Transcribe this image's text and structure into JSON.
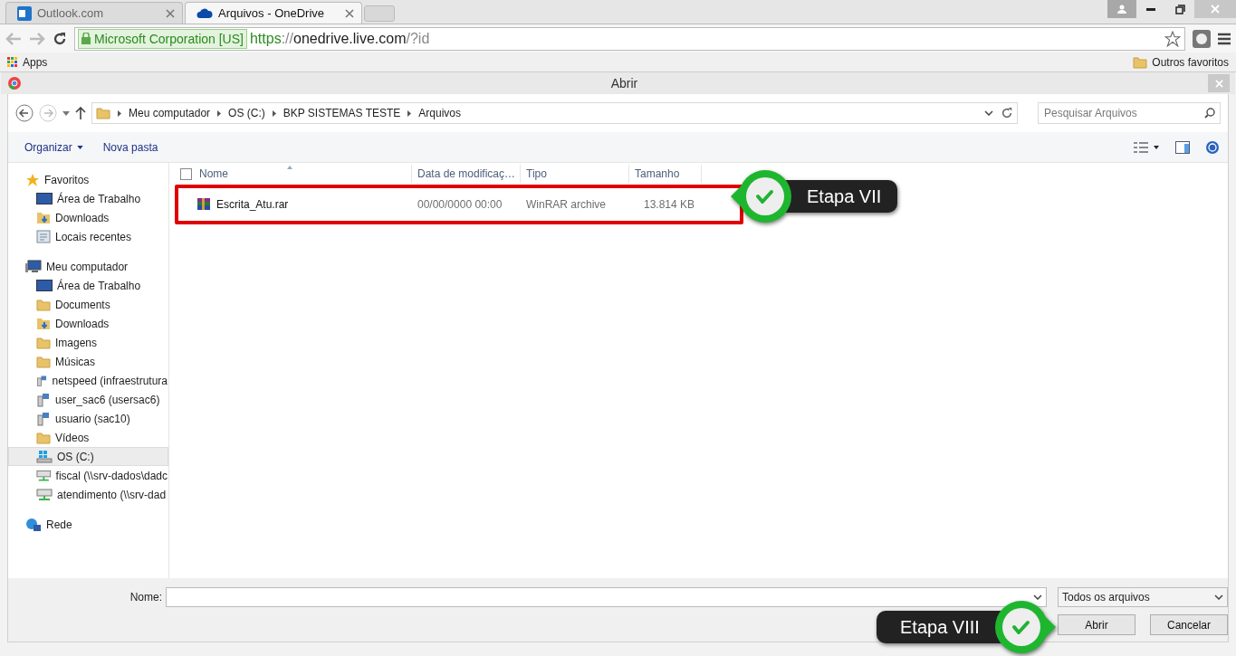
{
  "browser": {
    "tabs": [
      {
        "title": "Outlook.com",
        "kind": "mail",
        "selected": false
      },
      {
        "title": "Arquivos - OneDrive",
        "kind": "cloud",
        "selected": true
      }
    ],
    "security_label": "Microsoft Corporation [US]",
    "url": {
      "scheme": "https",
      "separator": "://",
      "host": "onedrive.live.com",
      "path": "/?id"
    },
    "bookmarks": {
      "apps": "Apps",
      "other": "Outros favoritos"
    }
  },
  "dialog": {
    "title": "Abrir",
    "breadcrumb": [
      "Meu computador",
      "OS (C:)",
      "BKP SISTEMAS TESTE",
      "Arquivos"
    ],
    "search": {
      "placeholder": "Pesquisar Arquivos"
    },
    "toolbar": [
      {
        "label": "Organizar",
        "kind": "menu"
      },
      {
        "label": "Nova pasta",
        "kind": "button"
      }
    ],
    "sidebar": [
      {
        "label": "Favoritos",
        "kind": "star",
        "children": [
          {
            "label": "Área de Trabalho",
            "kind": "desktop",
            "selected": false
          },
          {
            "label": "Downloads",
            "kind": "download",
            "selected": false
          },
          {
            "label": "Locais recentes",
            "kind": "recent",
            "selected": false
          }
        ]
      },
      {
        "label": "Meu computador",
        "kind": "computer",
        "children": [
          {
            "label": "Área de Trabalho",
            "kind": "desktop",
            "selected": false
          },
          {
            "label": "Documents",
            "kind": "folder",
            "selected": false
          },
          {
            "label": "Downloads",
            "kind": "download",
            "selected": false
          },
          {
            "label": "Imagens",
            "kind": "folder",
            "selected": false
          },
          {
            "label": "Músicas",
            "kind": "folder",
            "selected": false
          },
          {
            "label": "netspeed (infraestrutura",
            "kind": "user",
            "selected": false
          },
          {
            "label": "user_sac6 (usersac6)",
            "kind": "user",
            "selected": false
          },
          {
            "label": "usuario (sac10)",
            "kind": "user",
            "selected": false
          },
          {
            "label": "Vídeos",
            "kind": "folder",
            "selected": false
          },
          {
            "label": "OS (C:)",
            "kind": "drive",
            "selected": true
          },
          {
            "label": "fiscal (\\\\srv-dados\\dadc",
            "kind": "netdrive",
            "selected": false
          },
          {
            "label": "atendimento (\\\\srv-dad",
            "kind": "netdrive",
            "selected": false
          }
        ]
      },
      {
        "label": "Rede",
        "kind": "network"
      }
    ],
    "columns": [
      "Nome",
      "Data de modificaç…",
      "Tipo",
      "Tamanho"
    ],
    "rows": [
      {
        "name": "Escrita_Atu.rar",
        "date": "00/00/0000 00:00",
        "type": "WinRAR archive",
        "size": "13.814 KB",
        "highlighted": true
      }
    ],
    "name_label": "Nome:",
    "filter": "Todos os arquivos",
    "buttons": [
      "Abrir",
      "Cancelar"
    ],
    "callouts": [
      {
        "label": "Etapa VII",
        "kind": "row"
      },
      {
        "label": "Etapa VIII",
        "kind": "button"
      }
    ]
  }
}
